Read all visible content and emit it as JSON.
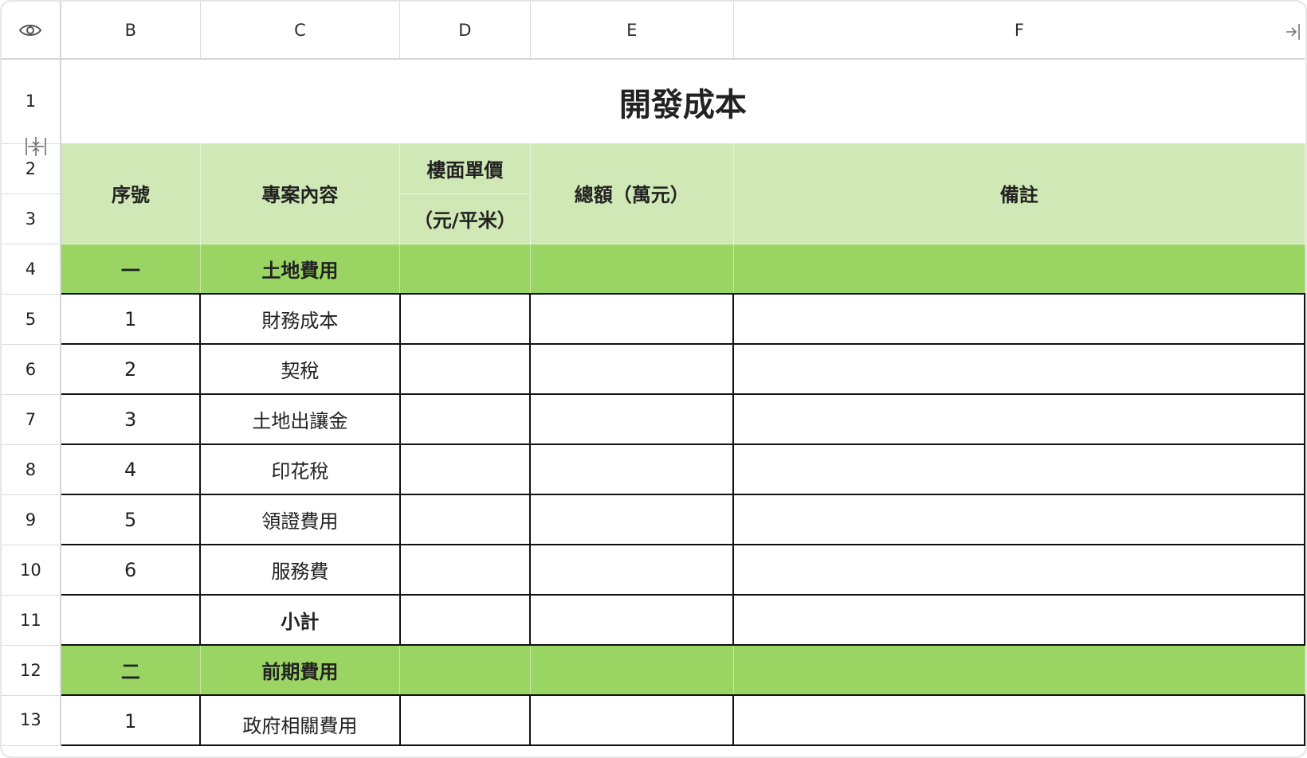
{
  "column_headers": [
    "B",
    "C",
    "D",
    "E",
    "F"
  ],
  "row_numbers": [
    "1",
    "2",
    "3",
    "4",
    "5",
    "6",
    "7",
    "8",
    "9",
    "10",
    "11",
    "12",
    "13"
  ],
  "sheet": {
    "title": "開發成本",
    "headers": {
      "seq": "序號",
      "content": "專案內容",
      "unit_price_top": "樓面單價",
      "unit_price_bottom": "（元/平米）",
      "total": "總額（萬元）",
      "note": "備註"
    },
    "section1": {
      "seq": "一",
      "name": "土地費用"
    },
    "section1_items": [
      {
        "seq": "1",
        "name": "財務成本"
      },
      {
        "seq": "2",
        "name": "契稅"
      },
      {
        "seq": "3",
        "name": "土地出讓金"
      },
      {
        "seq": "4",
        "name": "印花稅"
      },
      {
        "seq": "5",
        "name": "領證費用"
      },
      {
        "seq": "6",
        "name": "服務費"
      }
    ],
    "subtotal": "小計",
    "section2": {
      "seq": "二",
      "name": "前期費用"
    },
    "section2_items": [
      {
        "seq": "1",
        "name": "政府相關費用"
      }
    ]
  },
  "icons": {
    "visibility": "eye-icon",
    "row_resize": "row-resize-icon",
    "collapse_panel": "collapse-panel-icon"
  },
  "colors": {
    "header_light_green": "#cfe8b6",
    "section_green": "#9ad462"
  }
}
